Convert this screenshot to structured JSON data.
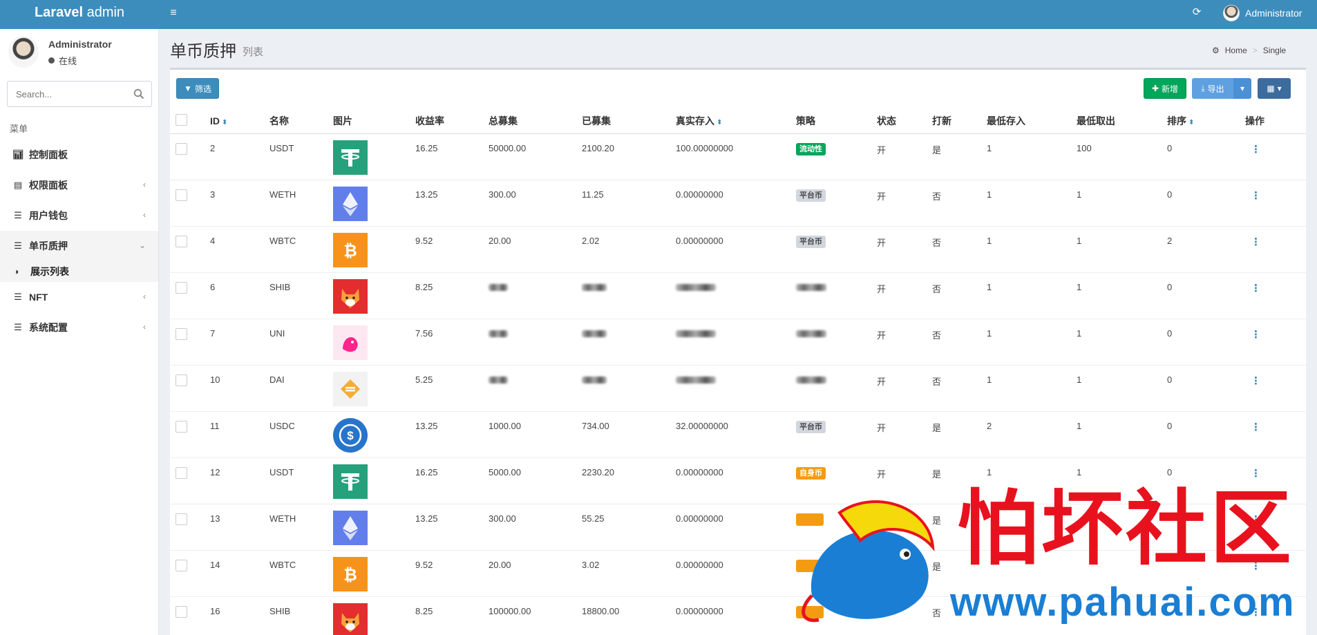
{
  "header": {
    "brand_bold": "Laravel",
    "brand_rest": " admin",
    "user": "Administrator"
  },
  "sidebar": {
    "user_name": "Administrator",
    "user_status": "在线",
    "search_placeholder": "Search...",
    "menu_header": "菜单",
    "items": [
      {
        "label": "控制面板"
      },
      {
        "label": "权限面板"
      },
      {
        "label": "用户钱包"
      },
      {
        "label": "单币质押"
      },
      {
        "label": "展示列表"
      },
      {
        "label": "NFT"
      },
      {
        "label": "系统配置"
      }
    ]
  },
  "content": {
    "title": "单币质押",
    "subtitle": "列表",
    "breadcrumb_home": "Home",
    "breadcrumb_current": "Single"
  },
  "toolbar": {
    "filter": "筛选",
    "new": "新增",
    "export": "导出"
  },
  "table": {
    "headers": [
      "ID",
      "名称",
      "图片",
      "收益率",
      "总募集",
      "已募集",
      "真实存入",
      "策略",
      "状态",
      "打新",
      "最低存入",
      "最低取出",
      "排序",
      "操作"
    ],
    "rows": [
      {
        "id": "2",
        "name": "USDT",
        "coin": "tether",
        "rate": "16.25",
        "total": "50000.00",
        "raised": "2100.20",
        "real": "100.00000000",
        "strategy": "流动性",
        "strategy_color": "green",
        "status": "开",
        "ipo": "是",
        "min_in": "1",
        "min_out": "100",
        "sort": "0"
      },
      {
        "id": "3",
        "name": "WETH",
        "coin": "eth",
        "rate": "13.25",
        "total": "300.00",
        "raised": "11.25",
        "real": "0.00000000",
        "strategy": "平台币",
        "strategy_color": "gray",
        "status": "开",
        "ipo": "否",
        "min_in": "1",
        "min_out": "1",
        "sort": "0"
      },
      {
        "id": "4",
        "name": "WBTC",
        "coin": "btc",
        "rate": "9.52",
        "total": "20.00",
        "raised": "2.02",
        "real": "0.00000000",
        "strategy": "平台币",
        "strategy_color": "gray",
        "status": "开",
        "ipo": "否",
        "min_in": "1",
        "min_out": "1",
        "sort": "2"
      },
      {
        "id": "6",
        "name": "SHIB",
        "coin": "shib",
        "rate": "8.25",
        "total": "",
        "raised": "",
        "real": "",
        "strategy": "",
        "strategy_color": "blur",
        "status": "开",
        "ipo": "否",
        "min_in": "1",
        "min_out": "1",
        "sort": "0"
      },
      {
        "id": "7",
        "name": "UNI",
        "coin": "uni",
        "rate": "7.56",
        "total": "",
        "raised": "",
        "real": "",
        "strategy": "",
        "strategy_color": "blur",
        "status": "开",
        "ipo": "否",
        "min_in": "1",
        "min_out": "1",
        "sort": "0"
      },
      {
        "id": "10",
        "name": "DAI",
        "coin": "dai",
        "rate": "5.25",
        "total": "",
        "raised": "",
        "real": "",
        "strategy": "",
        "strategy_color": "blur",
        "status": "开",
        "ipo": "否",
        "min_in": "1",
        "min_out": "1",
        "sort": "0"
      },
      {
        "id": "11",
        "name": "USDC",
        "coin": "usdc",
        "rate": "13.25",
        "total": "1000.00",
        "raised": "734.00",
        "real": "32.00000000",
        "strategy": "平台币",
        "strategy_color": "gray",
        "status": "开",
        "ipo": "是",
        "min_in": "2",
        "min_out": "1",
        "sort": "0"
      },
      {
        "id": "12",
        "name": "USDT",
        "coin": "tether",
        "rate": "16.25",
        "total": "5000.00",
        "raised": "2230.20",
        "real": "0.00000000",
        "strategy": "自身币",
        "strategy_color": "orange",
        "status": "开",
        "ipo": "是",
        "min_in": "1",
        "min_out": "1",
        "sort": "0"
      },
      {
        "id": "13",
        "name": "WETH",
        "coin": "eth",
        "rate": "13.25",
        "total": "300.00",
        "raised": "55.25",
        "real": "0.00000000",
        "strategy": "",
        "strategy_color": "orange",
        "status": "",
        "ipo": "是",
        "min_in": "",
        "min_out": "",
        "sort": ""
      },
      {
        "id": "14",
        "name": "WBTC",
        "coin": "btc",
        "rate": "9.52",
        "total": "20.00",
        "raised": "3.02",
        "real": "0.00000000",
        "strategy": "",
        "strategy_color": "orange",
        "status": "",
        "ipo": "是",
        "min_in": "",
        "min_out": "",
        "sort": ""
      },
      {
        "id": "16",
        "name": "SHIB",
        "coin": "shib",
        "rate": "8.25",
        "total": "100000.00",
        "raised": "18800.00",
        "real": "0.00000000",
        "strategy": "",
        "strategy_color": "orange",
        "status": "开",
        "ipo": "否",
        "min_in": "",
        "min_out": "",
        "sort": ""
      }
    ]
  },
  "watermark": {
    "cn": "怕坏社区",
    "url": "www.pahuai.com"
  },
  "colors": {
    "primary": "#3c8dbc",
    "success": "#00a65a",
    "warning": "#f39c12"
  }
}
